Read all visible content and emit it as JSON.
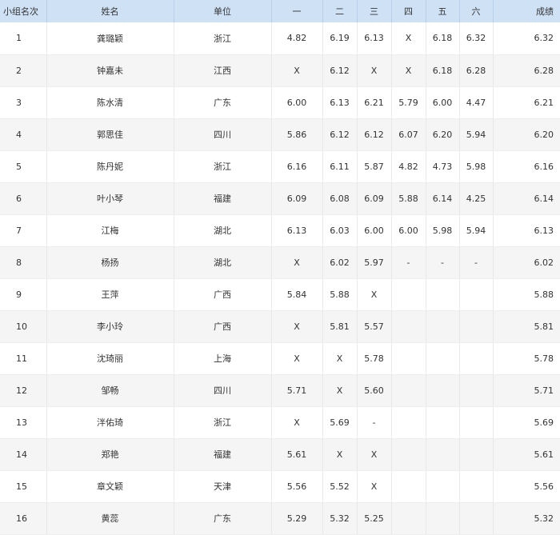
{
  "headers": [
    "小组名次",
    "姓名",
    "单位",
    "一",
    "二",
    "三",
    "四",
    "五",
    "六",
    "成绩"
  ],
  "rows": [
    [
      "1",
      "龚璐颖",
      "浙江",
      "4.82",
      "6.19",
      "6.13",
      "X",
      "6.18",
      "6.32",
      "6.32"
    ],
    [
      "2",
      "钟嘉未",
      "江西",
      "X",
      "6.12",
      "X",
      "X",
      "6.18",
      "6.28",
      "6.28"
    ],
    [
      "3",
      "陈水清",
      "广东",
      "6.00",
      "6.13",
      "6.21",
      "5.79",
      "6.00",
      "4.47",
      "6.21"
    ],
    [
      "4",
      "郭思佳",
      "四川",
      "5.86",
      "6.12",
      "6.12",
      "6.07",
      "6.20",
      "5.94",
      "6.20"
    ],
    [
      "5",
      "陈丹妮",
      "浙江",
      "6.16",
      "6.11",
      "5.87",
      "4.82",
      "4.73",
      "5.98",
      "6.16"
    ],
    [
      "6",
      "叶小琴",
      "福建",
      "6.09",
      "6.08",
      "6.09",
      "5.88",
      "6.14",
      "4.25",
      "6.14"
    ],
    [
      "7",
      "江梅",
      "湖北",
      "6.13",
      "6.03",
      "6.00",
      "6.00",
      "5.98",
      "5.94",
      "6.13"
    ],
    [
      "8",
      "杨扬",
      "湖北",
      "X",
      "6.02",
      "5.97",
      "-",
      "-",
      "-",
      "6.02"
    ],
    [
      "9",
      "王萍",
      "广西",
      "5.84",
      "5.88",
      "X",
      "",
      "",
      "",
      "5.88"
    ],
    [
      "10",
      "李小玲",
      "广西",
      "X",
      "5.81",
      "5.57",
      "",
      "",
      "",
      "5.81"
    ],
    [
      "11",
      "沈琦丽",
      "上海",
      "X",
      "X",
      "5.78",
      "",
      "",
      "",
      "5.78"
    ],
    [
      "12",
      "邹畅",
      "四川",
      "5.71",
      "X",
      "5.60",
      "",
      "",
      "",
      "5.71"
    ],
    [
      "13",
      "泮佑琦",
      "浙江",
      "X",
      "5.69",
      "-",
      "",
      "",
      "",
      "5.69"
    ],
    [
      "14",
      "郑艳",
      "福建",
      "5.61",
      "X",
      "X",
      "",
      "",
      "",
      "5.61"
    ],
    [
      "15",
      "章文颖",
      "天津",
      "5.56",
      "5.52",
      "X",
      "",
      "",
      "",
      "5.56"
    ],
    [
      "16",
      "黄蕊",
      "广东",
      "5.29",
      "5.32",
      "5.25",
      "",
      "",
      "",
      "5.32"
    ]
  ]
}
